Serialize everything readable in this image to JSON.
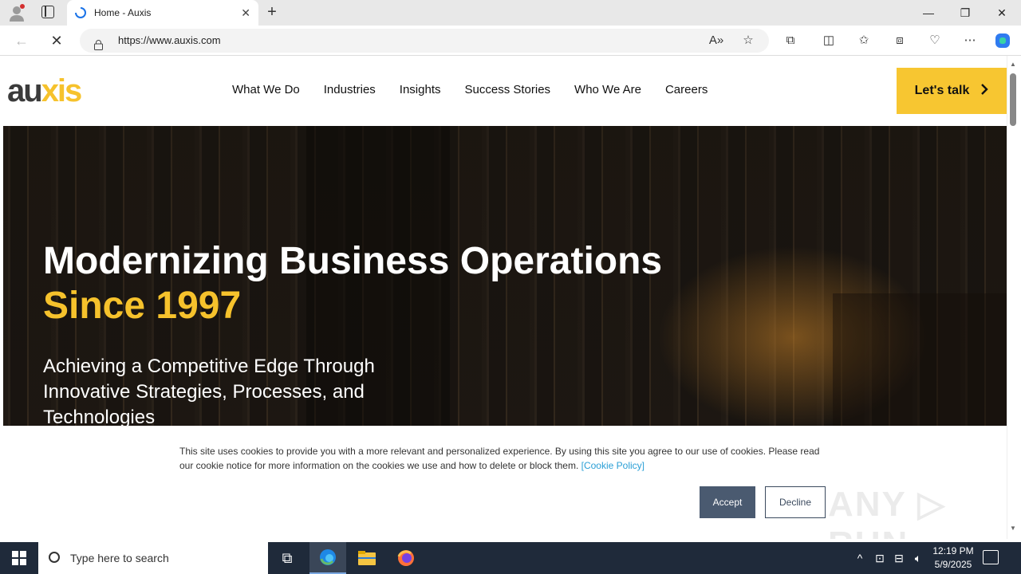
{
  "browser": {
    "tab_title": "Home - Auxis",
    "tab_close": "✕",
    "new_tab": "+",
    "url": "https://www.auxis.com",
    "window_controls": [
      "—",
      "❐",
      "✕"
    ]
  },
  "site": {
    "logo_prefix": "au",
    "logo_accent": "xis",
    "nav": [
      "What We Do",
      "Industries",
      "Insights",
      "Success Stories",
      "Who We Are",
      "Careers"
    ],
    "cta_label": "Let's talk",
    "hero_title": "Modernizing Business Operations",
    "hero_title_accent": "Since 1997",
    "hero_subtitle": "Achieving a Competitive Edge Through Innovative Strategies, Processes, and Technologies"
  },
  "cookie": {
    "text": "This site uses cookies to provide you with a more relevant and personalized experience. By using this site you agree to our use of cookies. Please read our cookie notice for more information on the cookies we use and how to delete or block them.",
    "policy_link": "[Cookie Policy]",
    "accept": "Accept",
    "decline": "Decline"
  },
  "watermark": "ANY RUN",
  "taskbar": {
    "search_placeholder": "Type here to search",
    "time": "12:19 PM",
    "date": "5/9/2025"
  },
  "colors": {
    "accent_yellow": "#f6c22c",
    "cookie_button": "#4a5a70",
    "taskbar": "#1f2a3a"
  }
}
